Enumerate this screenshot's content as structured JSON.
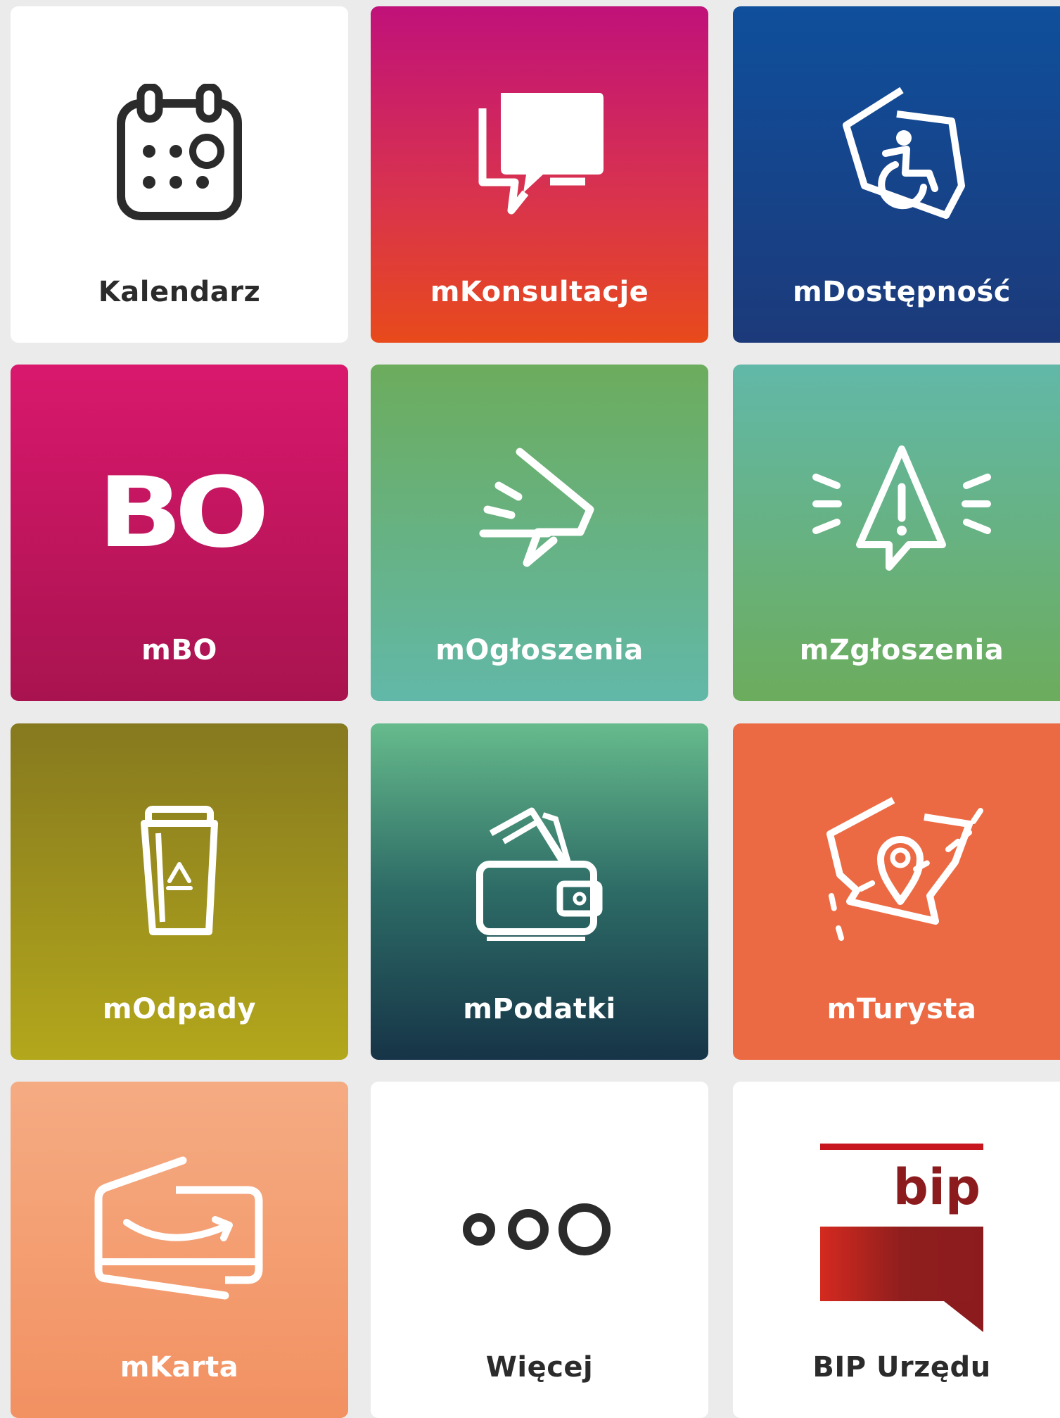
{
  "tiles": [
    {
      "id": "kalendarz",
      "label": "Kalendarz",
      "icon": "calendar-icon"
    },
    {
      "id": "konsultacje",
      "label": "mKonsultacje",
      "icon": "speech-bubbles-icon"
    },
    {
      "id": "dostepnosc",
      "label": "mDostępność",
      "icon": "accessibility-icon"
    },
    {
      "id": "bo",
      "label": "mBO",
      "icon": "bo-logo-icon",
      "icon_text": "BO"
    },
    {
      "id": "ogloszenia",
      "label": "mOgłoszenia",
      "icon": "announcement-icon"
    },
    {
      "id": "zgloszenia",
      "label": "mZgłoszenia",
      "icon": "warning-alert-icon"
    },
    {
      "id": "odpady",
      "label": "mOdpady",
      "icon": "recycle-bin-icon"
    },
    {
      "id": "podatki",
      "label": "mPodatki",
      "icon": "wallet-icon"
    },
    {
      "id": "turysta",
      "label": "mTurysta",
      "icon": "map-pin-icon"
    },
    {
      "id": "karta",
      "label": "mKarta",
      "icon": "card-icon"
    },
    {
      "id": "wiecej",
      "label": "Więcej",
      "icon": "more-dots-icon"
    },
    {
      "id": "bip",
      "label": "BIP Urzędu",
      "icon": "bip-logo-icon",
      "icon_text": "bip"
    }
  ],
  "colors": {
    "background": "#ebebeb",
    "label_dark": "#2b2b2b",
    "label_light": "#ffffff",
    "bip_red": "#c8161e"
  }
}
